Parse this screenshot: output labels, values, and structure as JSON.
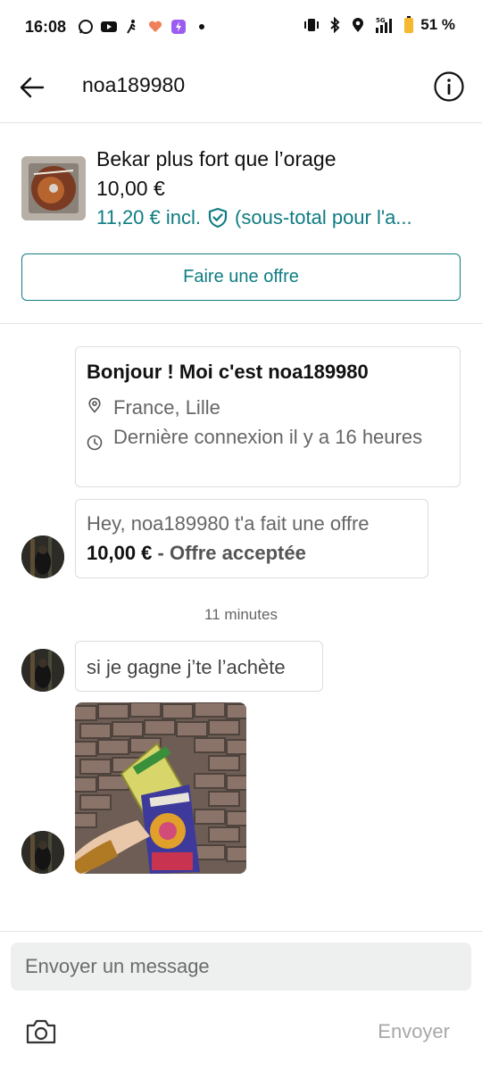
{
  "status_bar": {
    "time": "16:08",
    "battery_percent": "51 %",
    "left_icons": [
      "whatsapp-icon",
      "youtube-icon",
      "walk-icon",
      "heart-app-icon",
      "purple-app-icon",
      "dot-icon"
    ],
    "right_icons": [
      "vibrate-icon",
      "bluetooth-icon",
      "location-icon",
      "5g-signal-icon",
      "battery-icon"
    ]
  },
  "header": {
    "title": "noa189980",
    "back_icon": "arrow-left-icon",
    "info_icon": "info-circle-icon"
  },
  "item": {
    "title": "Bekar plus fort que l’orage",
    "price": "10,00 €",
    "total_price": "11,20 € incl.",
    "total_note": "(sous-total pour l'a...",
    "offer_button_label": "Faire une offre",
    "accent_color": "#0f7c82"
  },
  "profile_card": {
    "greeting": "Bonjour ! Moi c'est noa189980",
    "location": "France, Lille",
    "last_seen": "Dernière connexion il y a 16 heures"
  },
  "offer_message": {
    "text": "Hey, noa189980 t'a fait une offre",
    "price": "10,00 €",
    "status": " - Offre acceptée"
  },
  "timestamp": "11 minutes",
  "chat_message": "si je gagne j’te l’achète",
  "composer": {
    "placeholder": "Envoyer un message",
    "send_label": "Envoyer",
    "camera_icon": "camera-icon"
  }
}
